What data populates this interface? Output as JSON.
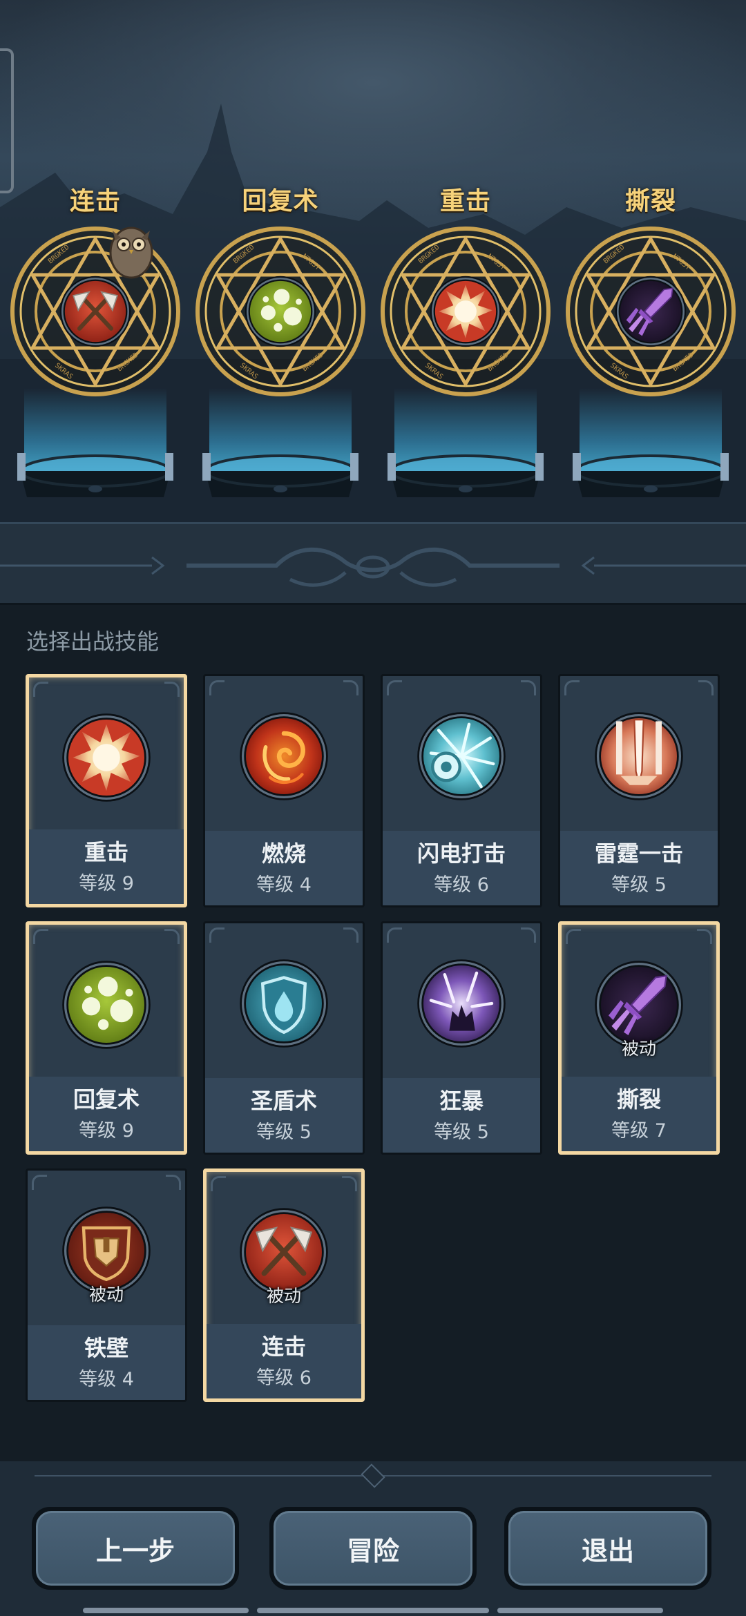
{
  "equipped": [
    {
      "name": "连击",
      "icon": "crossed-axes-icon"
    },
    {
      "name": "回复术",
      "icon": "healing-orbs-icon"
    },
    {
      "name": "重击",
      "icon": "burst-icon"
    },
    {
      "name": "撕裂",
      "icon": "purple-dagger-icon"
    }
  ],
  "pool": {
    "title": "选择出战技能",
    "cards": [
      {
        "name": "重击",
        "level": "等级 9",
        "passive": "",
        "selected": true,
        "icon": "burst-icon"
      },
      {
        "name": "燃烧",
        "level": "等级 4",
        "passive": "",
        "selected": false,
        "icon": "flame-swirl-icon"
      },
      {
        "name": "闪电打击",
        "level": "等级 6",
        "passive": "",
        "selected": false,
        "icon": "lightning-orb-icon"
      },
      {
        "name": "雷霆一击",
        "level": "等级 5",
        "passive": "",
        "selected": false,
        "icon": "thunder-sword-icon"
      },
      {
        "name": "回复术",
        "level": "等级 9",
        "passive": "",
        "selected": true,
        "icon": "healing-orbs-icon"
      },
      {
        "name": "圣盾术",
        "level": "等级 5",
        "passive": "",
        "selected": false,
        "icon": "holy-shield-icon"
      },
      {
        "name": "狂暴",
        "level": "等级 5",
        "passive": "",
        "selected": false,
        "icon": "rage-burst-icon"
      },
      {
        "name": "撕裂",
        "level": "等级 7",
        "passive": "被动",
        "selected": true,
        "icon": "purple-dagger-icon"
      },
      {
        "name": "铁壁",
        "level": "等级 4",
        "passive": "被动",
        "selected": false,
        "icon": "iron-wall-icon"
      },
      {
        "name": "连击",
        "level": "等级 6",
        "passive": "被动",
        "selected": true,
        "icon": "crossed-axes-icon"
      }
    ]
  },
  "buttons": {
    "back": "上一步",
    "adventure": "冒险",
    "exit": "退出"
  }
}
